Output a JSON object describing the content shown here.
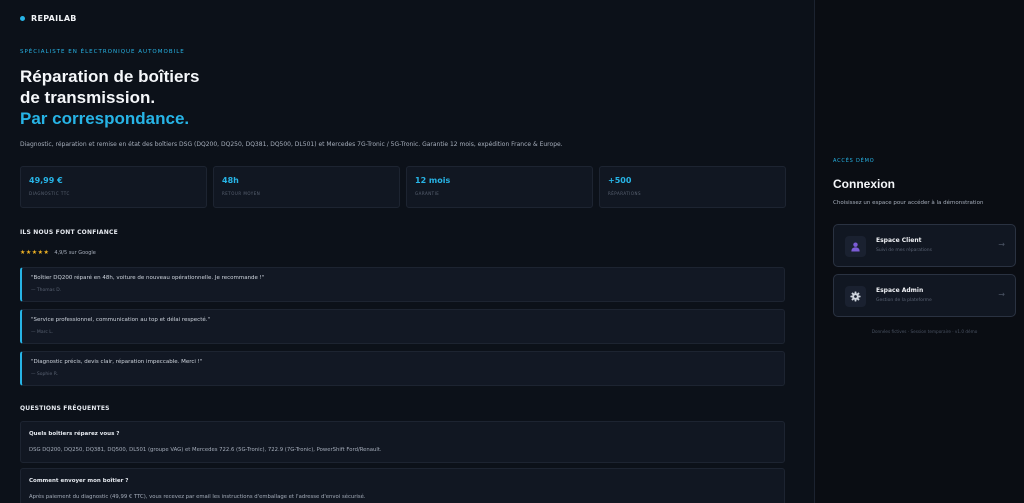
{
  "brand": {
    "name": "REPAILAB"
  },
  "hero": {
    "eyebrow": "Spécialiste en électronique automobile",
    "line1": "Réparation de boîtiers",
    "line2": "de transmission.",
    "line3": "Par correspondance.",
    "description": "Diagnostic, réparation et remise en état des boîtiers DSG (DQ200, DQ250, DQ381, DQ500, DL501) et Mercedes 7G-Tronic / 5G-Tronic. Garantie 12 mois, expédition France & Europe."
  },
  "stats": [
    {
      "value": "49,99 €",
      "label": "Diagnostic TTC"
    },
    {
      "value": "48h",
      "label": "Retour moyen"
    },
    {
      "value": "12 mois",
      "label": "Garantie"
    },
    {
      "value": "+500",
      "label": "Réparations"
    }
  ],
  "trust": {
    "title": "Ils nous font confiance",
    "stars": "★★★★★",
    "rating": "4,9/5 sur Google"
  },
  "reviews": [
    {
      "text": "\"Boîtier DQ200 réparé en 48h, voiture de nouveau opérationnelle. Je recommande !\"",
      "author": "— Thomas D."
    },
    {
      "text": "\"Service professionnel, communication au top et délai respecté.\"",
      "author": "— Marc L."
    },
    {
      "text": "\"Diagnostic précis, devis clair, réparation impeccable. Merci !\"",
      "author": "— Sophie R."
    }
  ],
  "faq": {
    "title": "Questions fréquentes",
    "items": [
      {
        "question": "Quels boîtiers réparez vous ?",
        "answer": "DSG DQ200, DQ250, DQ381, DQ500, DL501 (groupe VAG) et Mercedes 722.6 (5G-Tronic), 722.9 (7G-Tronic), PowerShift Ford/Renault."
      },
      {
        "question": "Comment envoyer mon boîtier ?",
        "answer": "Après paiement du diagnostic (49,99 € TTC), vous recevez par email les instructions d'emballage et l'adresse d'envoi sécurisé."
      }
    ]
  },
  "login": {
    "eyebrow": "Accès démo",
    "title": "Connexion",
    "subtitle": "Choisissez un espace pour accéder à la démonstration",
    "spaces": [
      {
        "name": "Espace Client",
        "desc": "Suivi de mes réparations",
        "icon": "user-icon"
      },
      {
        "name": "Espace Admin",
        "desc": "Gestion de la plateforme",
        "icon": "gear-icon"
      }
    ],
    "arrow": "→",
    "footer": "Données fictives · Session temporaire · v1.0 démo"
  },
  "colors": {
    "accent": "#27b4e6",
    "star": "#f0b324",
    "user_icon": "#7c5cd6"
  }
}
